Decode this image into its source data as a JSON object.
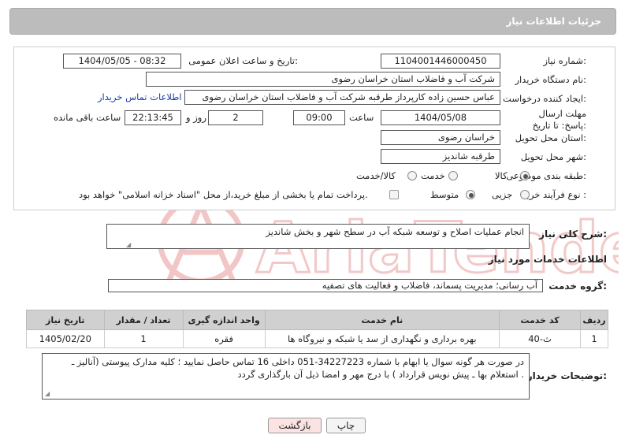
{
  "header": {
    "title": "جزئیات اطلاعات نیاز"
  },
  "form": {
    "need_number_label": "شماره نیاز:",
    "need_number": "1104001446000450",
    "announce_label": "تاریخ و ساعت اعلان عمومی:",
    "announce_value": "1404/05/05 - 08:32",
    "buyer_org_label": "نام دستگاه خریدار:",
    "buyer_org": "شرکت آب و فاضلاب استان خراسان رضوی",
    "creator_label": "ایجاد کننده درخواست:",
    "creator": "عباس حسین زاده کارپرداز طرقبه  شرکت آب و فاضلاب استان خراسان رضوی",
    "contact_link": "اطلاعات تماس خریدار",
    "deadline_label": "مهلت ارسال پاسخ: تا تاریخ:",
    "deadline_date": "1404/05/08",
    "time_label": "ساعت",
    "deadline_time": "09:00",
    "days_value": "2",
    "days_label": "روز و",
    "remaining_time": "22:13:45",
    "remaining_label": "ساعت باقی مانده",
    "province_label": "استان محل تحویل:",
    "province": "خراسان رضوی",
    "city_label": "شهر محل تحویل:",
    "city": "طرقبه شاندیز",
    "category_label": "طبقه بندی موضوعی:",
    "category_options": [
      "کالا",
      "خدمت",
      "کالا/خدمت"
    ],
    "process_label": "نوع فرآیند خرید :",
    "process_options": [
      "جزیی",
      "متوسط"
    ],
    "payment_note": "پرداخت تمام یا بخشی از مبلغ خرید،از محل \"اسناد خزانه اسلامی\" خواهد بود."
  },
  "summary": {
    "label": "شرح کلی نیاز:",
    "value": "انجام عملیات اصلاح و توسعه شبکه آب در سطح شهر و بخش شاندیز"
  },
  "services": {
    "section_title": "اطلاعات خدمات مورد نیاز",
    "group_label": "گروه خدمت:",
    "group_value": "آب رسانی؛ مدیریت پسماند، فاضلاب و فعالیت های تصفیه",
    "columns": [
      "ردیف",
      "کد خدمت",
      "نام خدمت",
      "واحد اندازه گیری",
      "تعداد / مقدار",
      "تاریخ نیاز"
    ],
    "rows": [
      [
        "1",
        "ث-40",
        "بهره برداری و نگهداری از سد یا شبکه و نیروگاه ها",
        "فقره",
        "1",
        "1405/02/20"
      ]
    ]
  },
  "notes": {
    "label": "توضیحات خریدار:",
    "line1": "در صورت هر گونه سوال یا ابهام با شماره 34227223-051 داخلی  16  تماس حاصل نمایید ؛ کلیه مدارک پیوستی (آنالیز ـ",
    "line2": "استعلام بها ـ پیش نویس قرارداد ) با درج مهر و امضا ذیل آن  بارگذاری گردد ."
  },
  "buttons": {
    "print": "چاپ",
    "back": "بازگشت"
  },
  "colors": {
    "header_bg": "#bcbcbc",
    "link": "#1a3ea8",
    "watermark": "#e05050"
  }
}
